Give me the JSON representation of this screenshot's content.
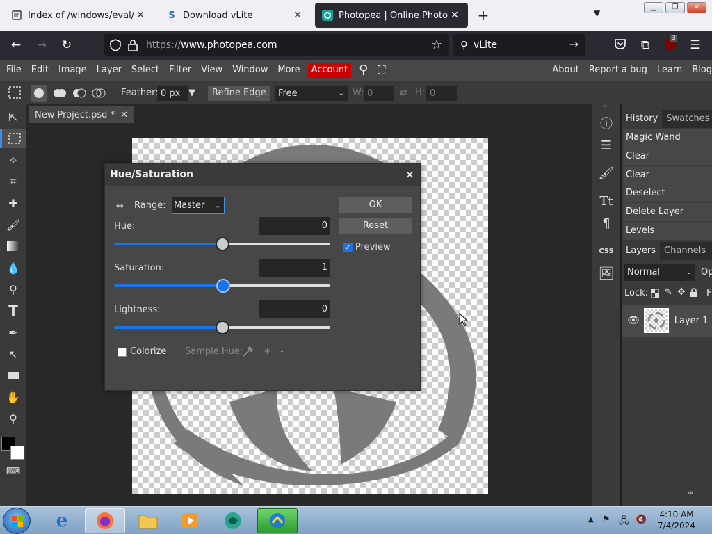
{
  "browser": {
    "tabs": [
      {
        "title": "Index of /windows/eval/",
        "favicon": "globe-icon"
      },
      {
        "title": "Download vLite",
        "favicon": "s-icon"
      },
      {
        "title": "Photopea | Online Photo Editor",
        "favicon": "photopea-icon"
      }
    ],
    "url_scheme": "https://",
    "url_host": "www.photopea.com",
    "search_text": "vLite",
    "extension_badge": "3"
  },
  "app": {
    "menu": [
      "File",
      "Edit",
      "Image",
      "Layer",
      "Select",
      "Filter",
      "View",
      "Window",
      "More"
    ],
    "account": "Account",
    "menu_right": [
      "About",
      "Report a bug",
      "Learn",
      "Blog"
    ],
    "options": {
      "feather_label": "Feather:",
      "feather_value": "0 px",
      "refine_edge": "Refine Edge",
      "style_value": "Free",
      "w_label": "W:",
      "w_value": "0",
      "h_label": "H:",
      "h_value": "0"
    },
    "document_tab": "New Project.psd *",
    "history_tabs": [
      "History",
      "Swatches"
    ],
    "history": [
      "Magic Wand",
      "Clear",
      "Clear",
      "Deselect",
      "Delete Layer",
      "Levels"
    ],
    "layer_tabs": [
      "Layers",
      "Channels"
    ],
    "blend_mode": "Normal",
    "opacity_label": "Op",
    "lock_label": "Lock:",
    "fill_label": "F",
    "layer_name": "Layer 1",
    "side_text_icon": "Tt",
    "side_css": "CSS"
  },
  "dialog": {
    "title": "Hue/Saturation",
    "range_label": "Range:",
    "range_value": "Master",
    "hue_label": "Hue:",
    "hue_value": "0",
    "hue_fraction": 0.5,
    "saturation_label": "Saturation:",
    "saturation_value": "1",
    "saturation_fraction": 0.505,
    "lightness_label": "Lightness:",
    "lightness_value": "0",
    "lightness_fraction": 0.5,
    "ok": "OK",
    "reset": "Reset",
    "preview_label": "Preview",
    "preview_checked": true,
    "colorize_label": "Colorize",
    "colorize_checked": false,
    "sample_hue_label": "Sample Hue:",
    "sample_plus": "+",
    "sample_minus": "-"
  },
  "taskbar": {
    "time": "4:10 AM",
    "date": "7/4/2024"
  },
  "colors": {
    "accent": "#1a73e8",
    "account": "#cc0000",
    "panel": "#474747"
  }
}
